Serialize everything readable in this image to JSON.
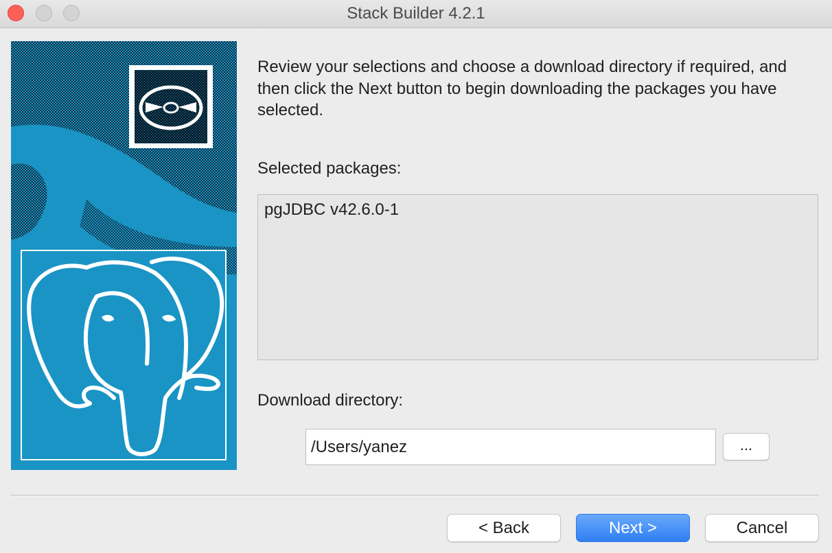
{
  "window": {
    "title": "Stack Builder 4.2.1"
  },
  "intro_text": "Review your selections and choose a download directory if required, and then click the Next button to begin downloading the packages you have selected.",
  "selected_packages": {
    "label": "Selected packages:",
    "items": [
      "pgJDBC v42.6.0-1"
    ]
  },
  "download_directory": {
    "label": "Download directory:",
    "value": "/Users/yanez",
    "browse_label": "..."
  },
  "buttons": {
    "back": "< Back",
    "next": "Next >",
    "cancel": "Cancel"
  },
  "colors": {
    "accent": "#2f7ff3",
    "art_blue": "#1a94c4",
    "art_dark": "#0d2233"
  },
  "icons": {
    "art_badge": "disc-icon",
    "art_logo": "postgresql-elephant-icon"
  }
}
